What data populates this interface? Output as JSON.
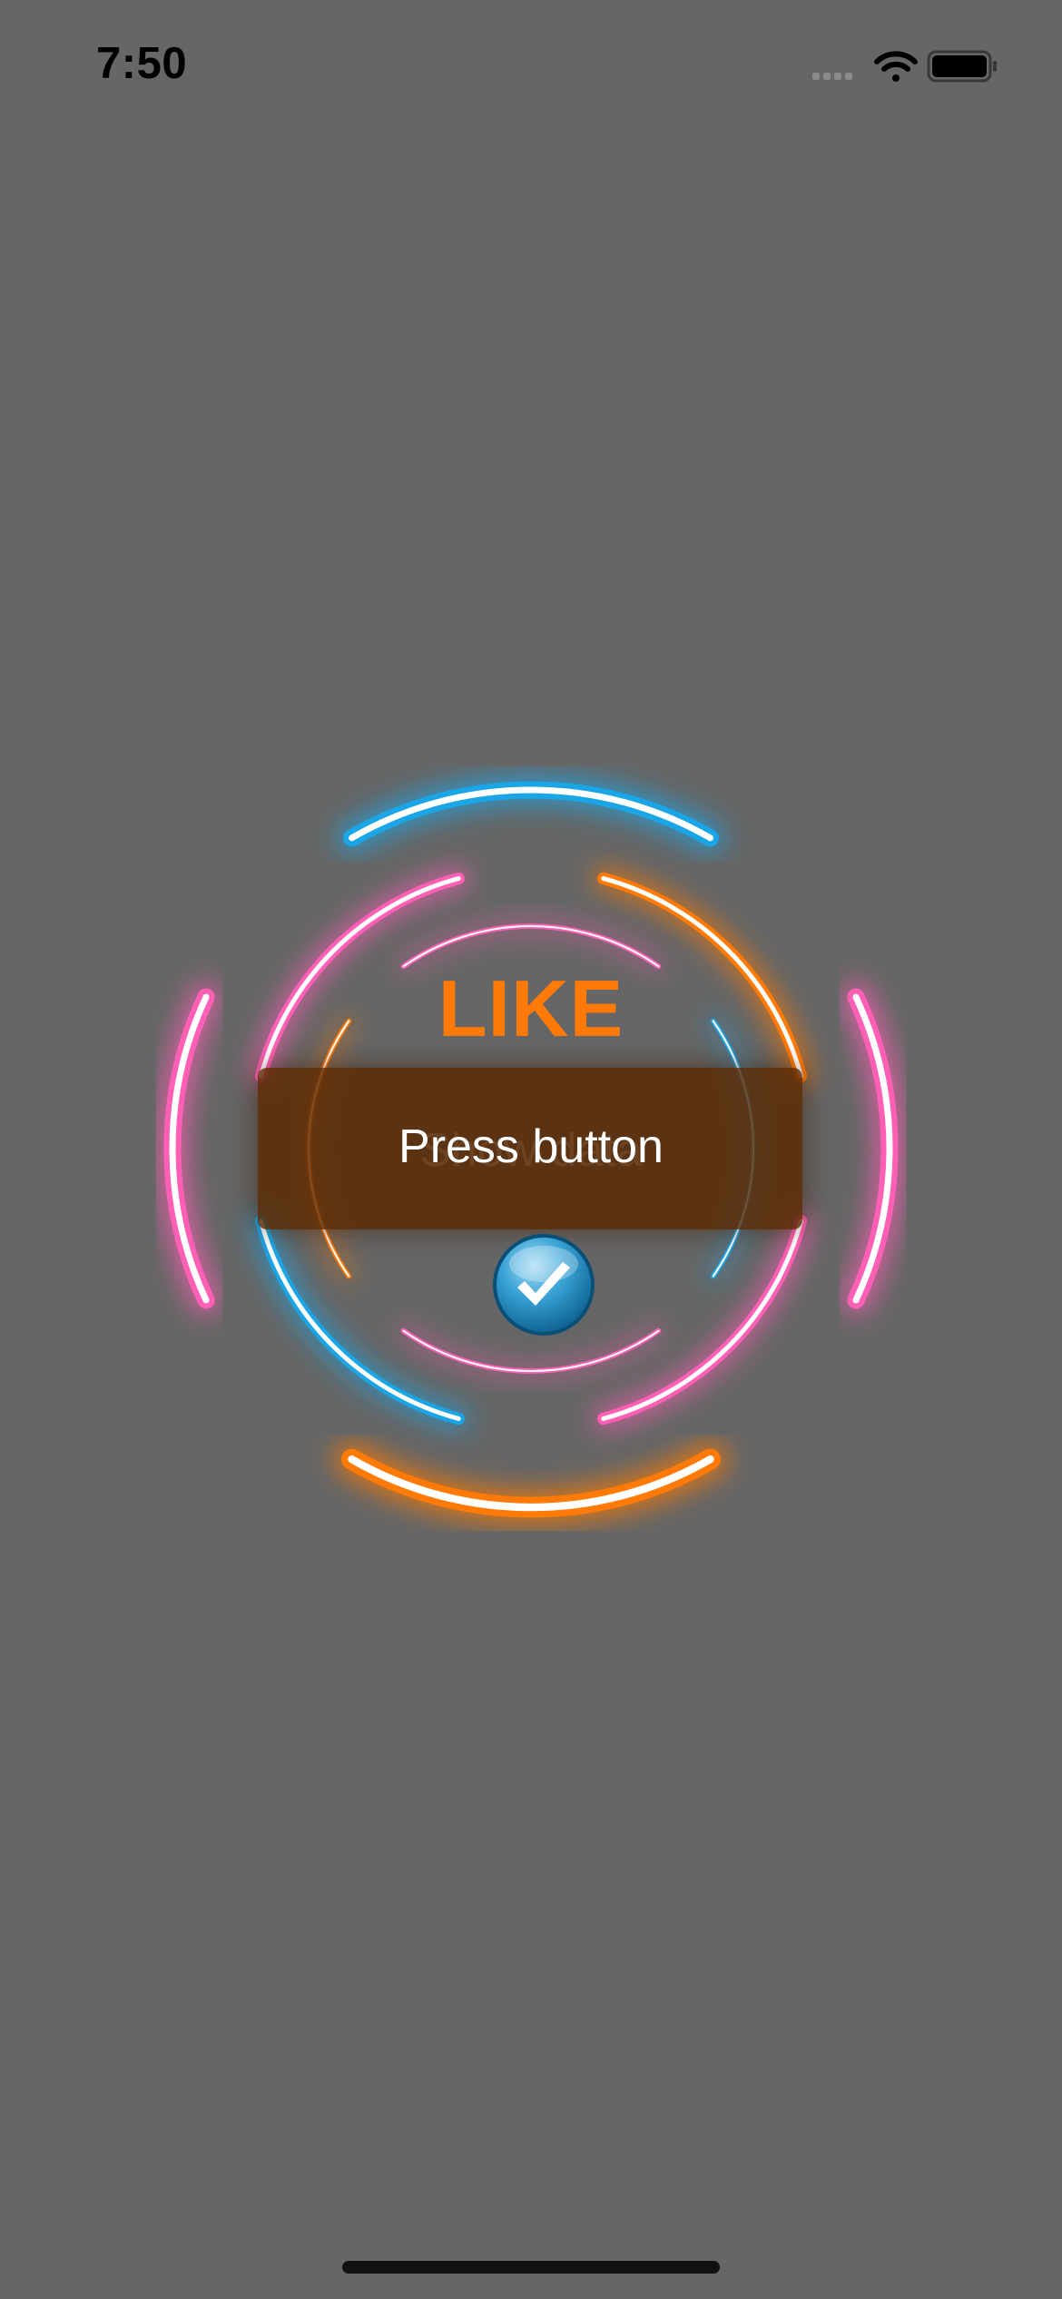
{
  "status_bar": {
    "time": "7:50",
    "icons": [
      "cellular-signal-icon",
      "wifi-icon",
      "battery-icon"
    ]
  },
  "neon": {
    "title": "LIKE",
    "button_label": "Press button",
    "ghost_label": "Show data",
    "colors": {
      "blue": "#1aa6e6",
      "pink": "#ff5fb5",
      "orange": "#ff7a06",
      "background": "#666666"
    }
  },
  "check_button": {
    "icon": "checkmark-icon"
  }
}
